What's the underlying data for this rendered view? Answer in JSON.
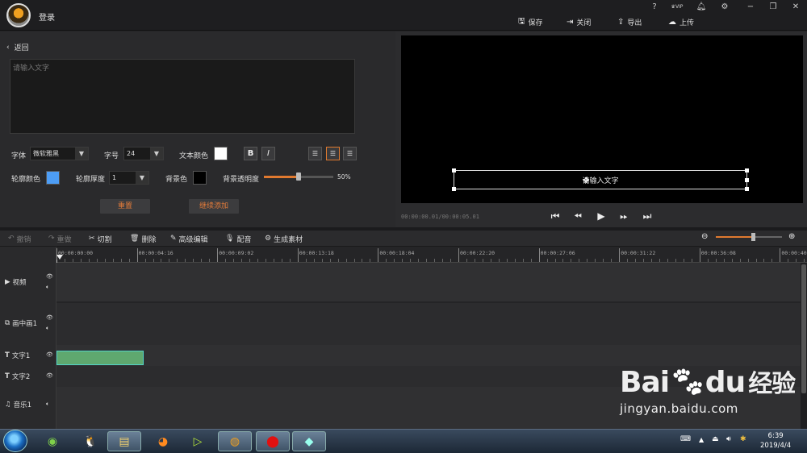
{
  "titlebar": {
    "login": "登录",
    "help": "?",
    "vip": "VIP",
    "save": "保存",
    "close": "关闭",
    "export": "导出",
    "upload": "上传"
  },
  "editor": {
    "back": "返回",
    "placeholder": "请输入文字",
    "font_label": "字体",
    "font_value": "微软雅黑",
    "size_label": "字号",
    "size_value": "24",
    "text_color_label": "文本颜色",
    "bold": "B",
    "italic": "I",
    "outline_color_label": "轮廓颜色",
    "outline_width_label": "轮廓厚度",
    "outline_width_value": "1",
    "bg_color_label": "背景色",
    "bg_opacity_label": "背景透明度",
    "bg_opacity_value": "50%",
    "bg_opacity_fraction": 0.5,
    "reset": "重置",
    "continue_add": "继续添加",
    "colors": {
      "text": "#ffffff",
      "outline": "#4d9df5",
      "bg": "#000000",
      "accent": "#e0792f"
    }
  },
  "preview": {
    "overlay_text": "请输入文字",
    "timecode": "00:00:00.01/00:00:05.01"
  },
  "toolbar": {
    "undo": "撤销",
    "redo": "重做",
    "cut": "切割",
    "delete": "删除",
    "advanced": "高级编辑",
    "dub": "配音",
    "generate": "生成素材",
    "zoom_fraction": 0.56
  },
  "ruler": [
    "00:00:00:00",
    "00:00:04:16",
    "00:00:09:02",
    "00:00:13:18",
    "00:00:18:04",
    "00:00:22:20",
    "00:00:27:06",
    "00:00:31:22",
    "00:00:36:08",
    "00:00:40:"
  ],
  "tracks": {
    "video": "视频",
    "pip": "画中画1",
    "text1": "文字1",
    "text2": "文字2",
    "music": "音乐1"
  },
  "taskbar": {
    "time": "6:39",
    "date": "2019/4/4"
  },
  "watermark": {
    "brand_a": "Bai",
    "brand_b": "du",
    "brand_c": "经验",
    "url": "jingyan.baidu.com"
  }
}
